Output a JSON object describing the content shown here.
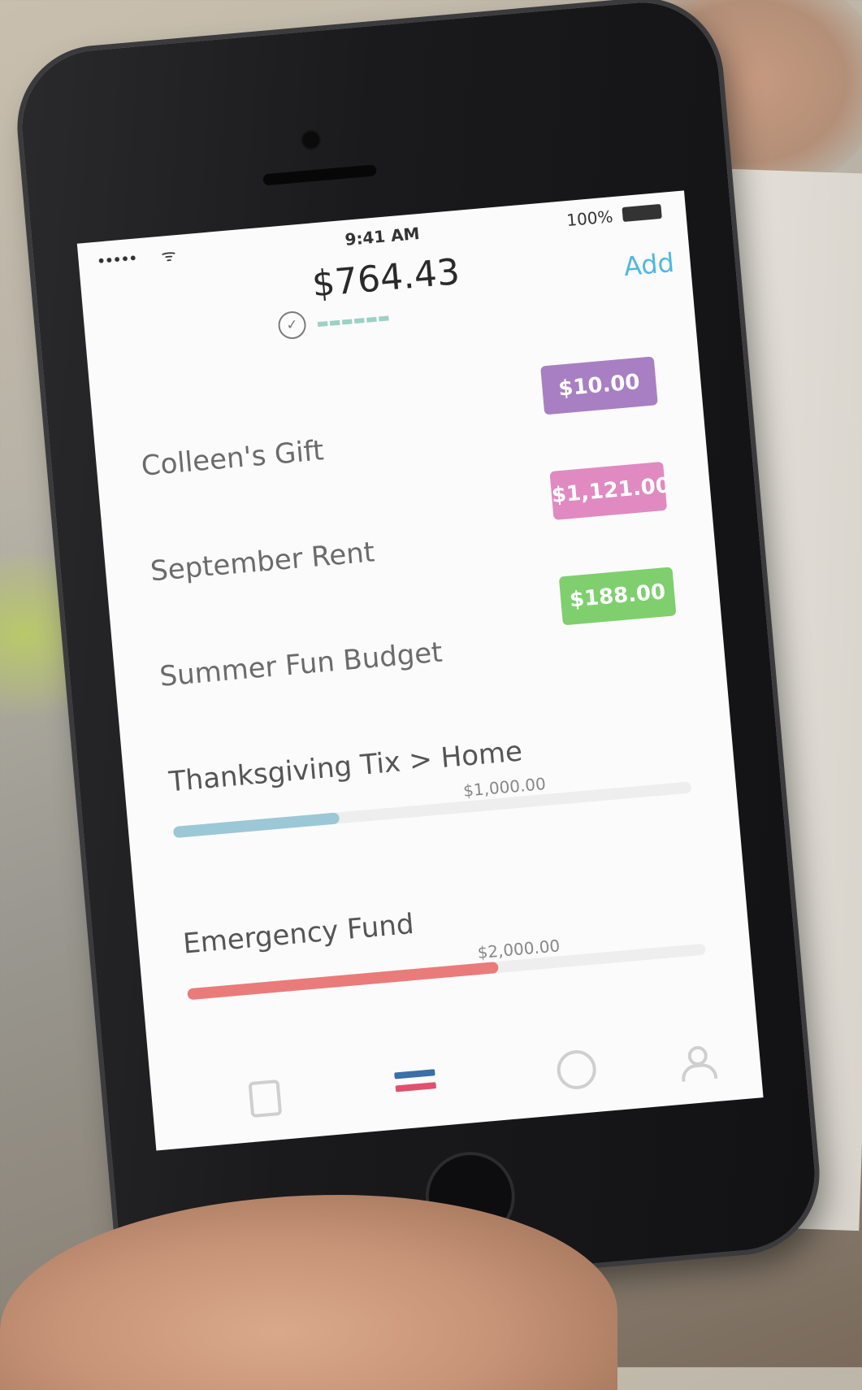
{
  "status_bar": {
    "signal": "•••••",
    "wifi": "ᯤ",
    "time": "9:41 AM",
    "battery": "100%"
  },
  "header": {
    "balance": "$764.43",
    "add_label": "Add"
  },
  "envelopes": [
    {
      "name": "Colleen's Gift",
      "amount": "$10.00",
      "color": "#a87fc3"
    },
    {
      "name": "September Rent",
      "amount": "$1,121.00",
      "color": "#e08ac1"
    },
    {
      "name": "Summer Fun Budget",
      "amount": "$188.00",
      "color": "#7fcf6e"
    }
  ],
  "goals": [
    {
      "name": "Thanksgiving Tix > Home",
      "target": "$1,000.00",
      "progress": 0.32,
      "color": "#9cc7d6"
    },
    {
      "name": "Emergency Fund",
      "target": "$2,000.00",
      "progress": 0.6,
      "color": "#ea7b7b"
    }
  ],
  "tab_icons": [
    "document-icon",
    "envelopes-icon",
    "chat-icon",
    "person-icon"
  ]
}
